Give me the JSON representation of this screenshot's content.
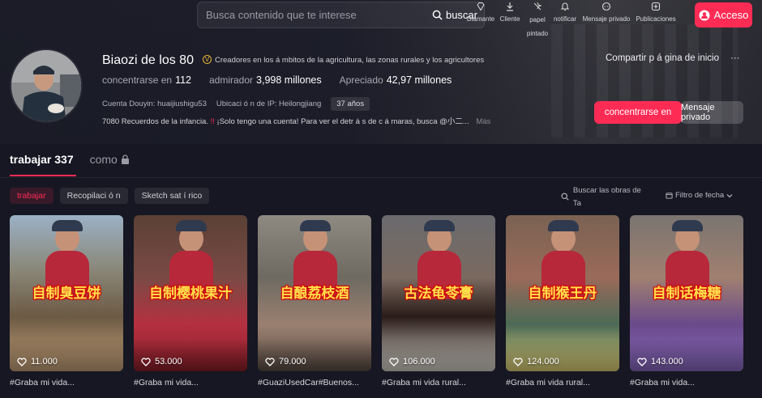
{
  "header": {
    "search_placeholder": "Busca contenido que te interese",
    "search_button": "buscar",
    "nav": [
      {
        "icon": "diamond-icon",
        "label": "Diamante"
      },
      {
        "icon": "download-icon",
        "label": "Cliente"
      },
      {
        "icon": "wallpaper-icon",
        "label": "papel pintado"
      },
      {
        "icon": "bell-icon",
        "label": "notificar"
      },
      {
        "icon": "message-icon",
        "label": "Mensaje privado"
      },
      {
        "icon": "plus-icon",
        "label": "Publicaciones"
      }
    ],
    "login_label": "Acceso"
  },
  "profile": {
    "name": "Biaozi de los 80",
    "verify_badge": "V",
    "verification": "Creadores en los á mbitos de la agricultura, las zonas rurales y los agricultores",
    "stats": [
      {
        "label": "concentrarse en",
        "value": "112"
      },
      {
        "label": "admirador",
        "value": "3,998 millones"
      },
      {
        "label": "Apreciado",
        "value": "42,97 millones"
      }
    ],
    "douyin_account": "Cuenta Douyin: huaijiushigu53",
    "ip_location": "Ubicaci ó n de IP: Heilongjiang",
    "age": "37 años",
    "bio_start": "7080 Recuerdos de la infancia.",
    "bio_mark": "!!",
    "bio_rest": "¡Solo tengo una cuenta! Para ver el detr á s de c á maras, busca @小二...",
    "bio_more": "Más",
    "share_label": "Compartir p á gina de inicio",
    "more_label": "···",
    "follow_label": "concentrarse en",
    "message_label": "Mensaje privado"
  },
  "tabs": {
    "works_label": "trabajar",
    "works_count": "337",
    "liked_label": "como"
  },
  "filters": {
    "chips": [
      "trabajar",
      "Recopilaci ó n",
      "Sketch sat í rico"
    ],
    "search_works": "Buscar las obras de Ta",
    "date_filter": "Filtro de fecha"
  },
  "videos": [
    {
      "caption": "自制臭豆饼",
      "likes": "11.000",
      "title": "#Graba mi vida...",
      "scene": "brown"
    },
    {
      "caption": "自制樱桃果汁",
      "likes": "53.000",
      "title": "#Graba mi vida...",
      "scene": "red"
    },
    {
      "caption": "自酿荔枝酒",
      "likes": "79.000",
      "title": "#GuaziUsedCar#Buenos...",
      "scene": "grey"
    },
    {
      "caption": "古法龟苓膏",
      "likes": "106.000",
      "title": "#Graba mi vida rural...",
      "scene": "dark"
    },
    {
      "caption": "自制猴王丹",
      "likes": "124.000",
      "title": "#Graba mi vida rural...",
      "scene": "green"
    },
    {
      "caption": "自制话梅糖",
      "likes": "143.000",
      "title": "#Graba mi vida...",
      "scene": "purple"
    }
  ],
  "colors": {
    "accent": "#fe2c55",
    "background": "#161722"
  }
}
